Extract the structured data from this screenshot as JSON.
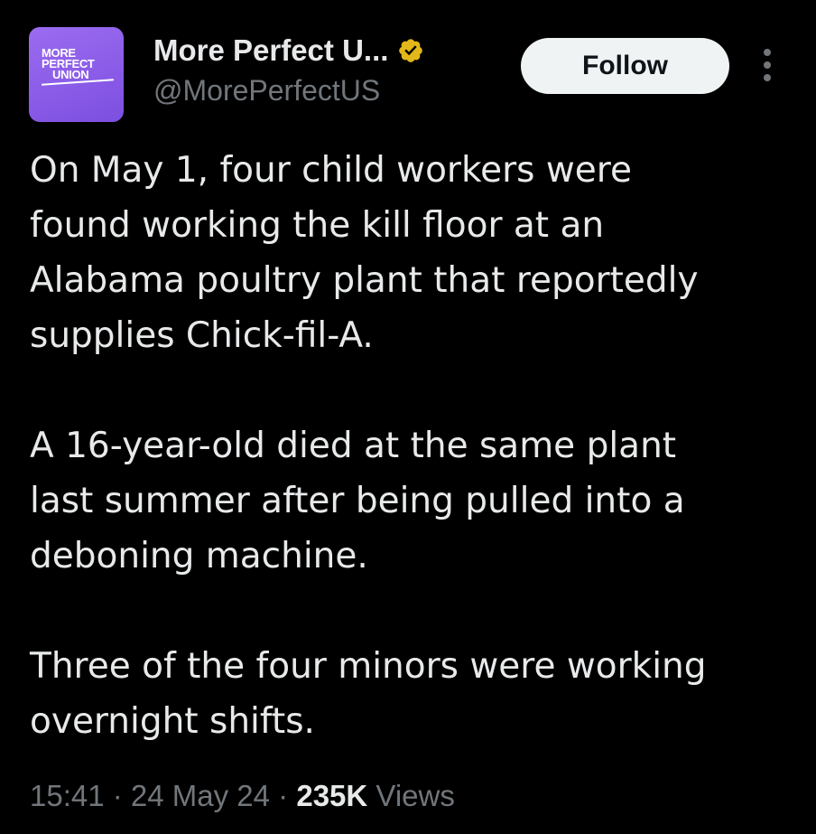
{
  "author": {
    "avatar_logo_lines": [
      "MORE",
      "PERFECT",
      "UNION"
    ],
    "display_name": "More Perfect U...",
    "handle": "@MorePerfectUS",
    "verified_badge_icon": "verified-badge-icon",
    "verified_badge_color": "#e2b719",
    "avatar_color": "#8b5cf0"
  },
  "actions": {
    "follow_label": "Follow",
    "more_icon": "more-options-icon"
  },
  "tweet": {
    "paragraphs": [
      "On May 1, four child workers were\nfound working the kill floor at an\nAlabama poultry plant that reportedly\nsupplies Chick-fil-A.",
      "A 16-year-old died at the same plant\nlast summer after being pulled into a\ndeboning machine.",
      "Three of the four minors were working\novernight shifts."
    ]
  },
  "meta": {
    "time": "15:41",
    "separator": " · ",
    "date": "24 May 24",
    "views_count": "235K",
    "views_label": " Views"
  }
}
